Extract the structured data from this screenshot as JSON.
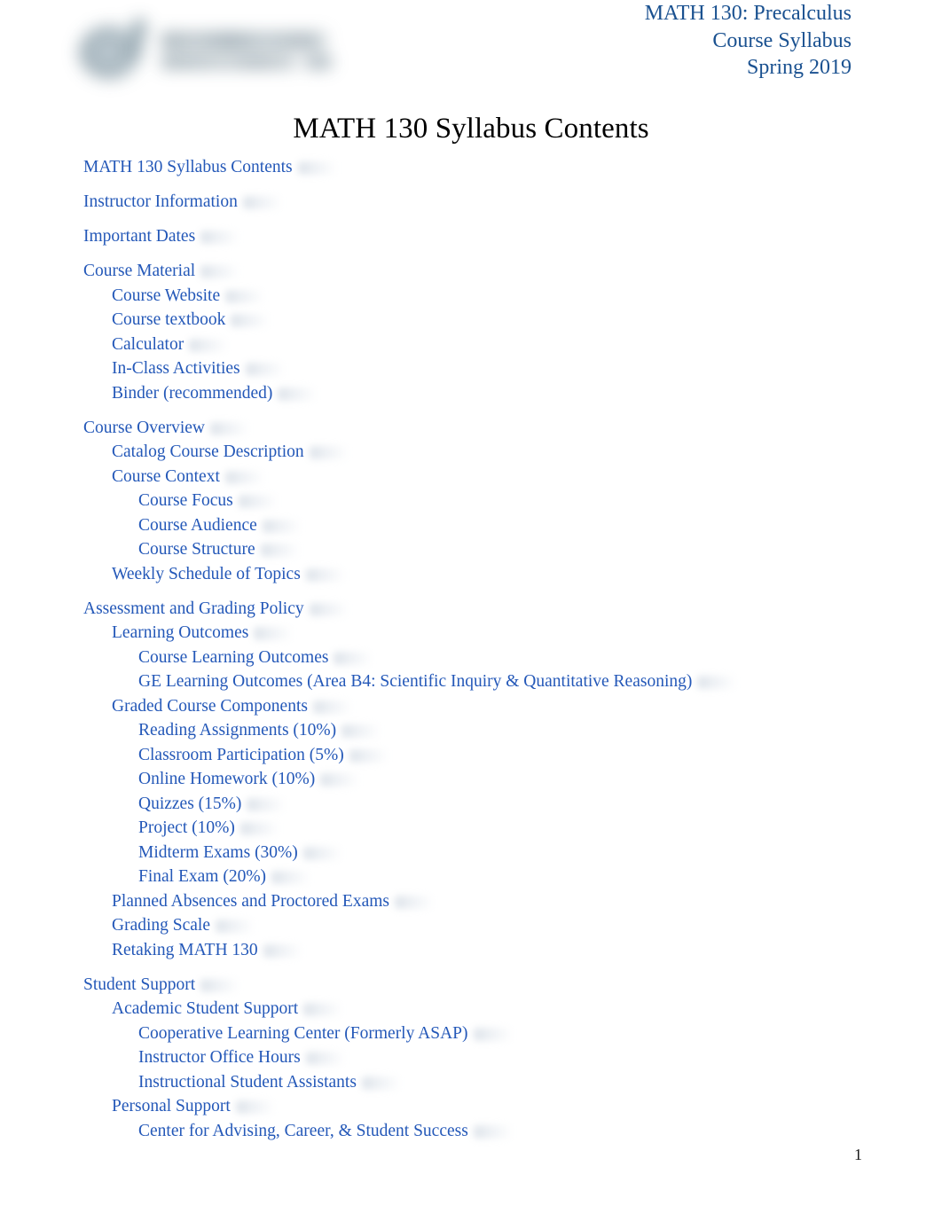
{
  "header": {
    "line1": "MATH 130: Precalculus",
    "line2": "Course Syllabus",
    "line3": "Spring 2019",
    "logo_alt": "university-logo-redacted",
    "color": "#1a5190"
  },
  "document": {
    "title": "MATH 130 Syllabus Contents",
    "title_color": "#000000",
    "link_color": "#2458b8",
    "page_number": "1"
  },
  "toc": {
    "entries": [
      {
        "label": "MATH 130 Syllabus Contents",
        "level": 1
      },
      {
        "label": "Instructor Information",
        "level": 1
      },
      {
        "label": "Important Dates",
        "level": 1
      },
      {
        "label": "Course Material",
        "level": 1
      },
      {
        "label": "Course Website",
        "level": 2
      },
      {
        "label": "Course textbook",
        "level": 2
      },
      {
        "label": "Calculator",
        "level": 2
      },
      {
        "label": "In-Class Activities",
        "level": 2
      },
      {
        "label": "Binder (recommended)",
        "level": 2
      },
      {
        "label": "Course Overview",
        "level": 1
      },
      {
        "label": "Catalog Course Description",
        "level": 2
      },
      {
        "label": "Course Context",
        "level": 2
      },
      {
        "label": "Course Focus",
        "level": 3
      },
      {
        "label": "Course Audience",
        "level": 3
      },
      {
        "label": "Course Structure",
        "level": 3
      },
      {
        "label": "Weekly Schedule of Topics",
        "level": 2
      },
      {
        "label": "Assessment and Grading Policy",
        "level": 1
      },
      {
        "label": "Learning Outcomes",
        "level": 2
      },
      {
        "label": "Course Learning Outcomes",
        "level": 3
      },
      {
        "label": "GE Learning Outcomes (Area B4: Scientific Inquiry & Quantitative Reasoning)",
        "level": 3
      },
      {
        "label": "Graded Course Components",
        "level": 2
      },
      {
        "label": "Reading Assignments (10%)",
        "level": 3
      },
      {
        "label": "Classroom Participation (5%)",
        "level": 3
      },
      {
        "label": "Online Homework (10%)",
        "level": 3
      },
      {
        "label": "Quizzes (15%)",
        "level": 3
      },
      {
        "label": "Project (10%)",
        "level": 3
      },
      {
        "label": "Midterm Exams (30%)",
        "level": 3
      },
      {
        "label": "Final Exam (20%)",
        "level": 3
      },
      {
        "label": "Planned Absences and Proctored Exams",
        "level": 2
      },
      {
        "label": "Grading Scale",
        "level": 2
      },
      {
        "label": "Retaking MATH 130",
        "level": 2
      },
      {
        "label": "Student Support",
        "level": 1
      },
      {
        "label": "Academic Student Support",
        "level": 2
      },
      {
        "label": "Cooperative Learning Center (Formerly ASAP)",
        "level": 3
      },
      {
        "label": "Instructor Office Hours",
        "level": 3
      },
      {
        "label": "Instructional Student Assistants",
        "level": 3
      },
      {
        "label": "Personal Support",
        "level": 2
      },
      {
        "label": "Center for Advising, Career, & Student Success",
        "level": 3
      }
    ]
  }
}
